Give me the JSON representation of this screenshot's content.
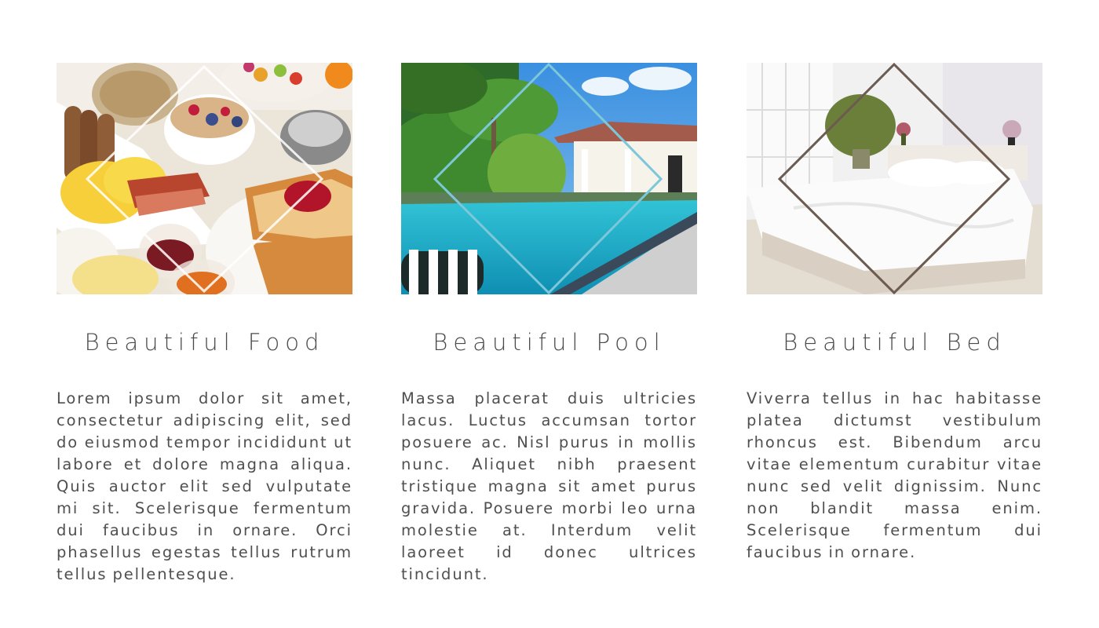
{
  "cards": [
    {
      "title": "Beautiful Food",
      "text": "Lorem ipsum dolor sit amet, consectetur adipiscing elit, sed do eiusmod tempor incididunt ut labore et dolore magna aliqua. Quis auctor elit sed vulputate mi sit. Scelerisque fermentum dui faucibus in ornare. Orci phasellus egestas tellus rutrum tellus pellentesque.",
      "frame_color": "#ffffff"
    },
    {
      "title": "Beautiful Pool",
      "text": "Massa placerat duis ultricies lacus. Luctus accumsan tortor posuere ac. Nisl purus in mollis nunc. Aliquet nibh praesent tristique magna sit amet purus gravida. Posuere morbi leo urna molestie at. Interdum velit laoreet id donec ultrices tincidunt.",
      "frame_color": "#7cc7d8"
    },
    {
      "title": "Beautiful Bed",
      "text": "Viverra tellus in hac habitasse platea dictumst vestibulum rhoncus est. Bibendum arcu vitae elementum curabitur vitae nunc sed velit dignissim. Nunc non blandit massa enim. Scelerisque fermentum dui faucibus in ornare.",
      "frame_color": "#6b5b50"
    }
  ],
  "colors": {
    "heading": "#4a4a4a",
    "body": "#4f4f4f",
    "background": "#ffffff"
  }
}
